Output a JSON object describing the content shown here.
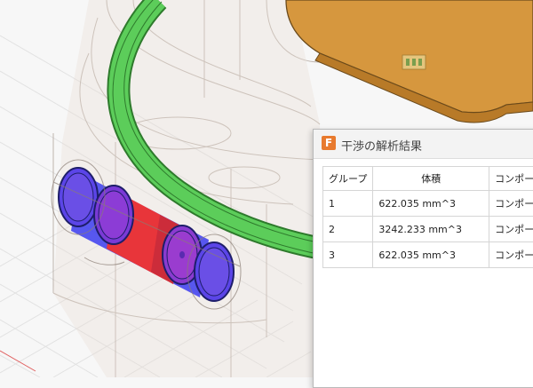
{
  "dialog": {
    "icon_letter": "F",
    "title": "干渉の解析結果",
    "columns": [
      "グループ",
      "体積",
      "コンポーネ"
    ],
    "rows": [
      {
        "group": "1",
        "volume": "622.035 mm^3",
        "component": "コンポーネ"
      },
      {
        "group": "2",
        "volume": "3242.233 mm^3",
        "component": "コンポーネ"
      },
      {
        "group": "3",
        "volume": "622.035 mm^3",
        "component": "コンポーネ"
      }
    ]
  },
  "colors": {
    "interference_red": "#e8353a",
    "pipe_blue": "#3c3cf0",
    "ring_green": "#5ccd5a",
    "block_orange": "#d6973e"
  }
}
